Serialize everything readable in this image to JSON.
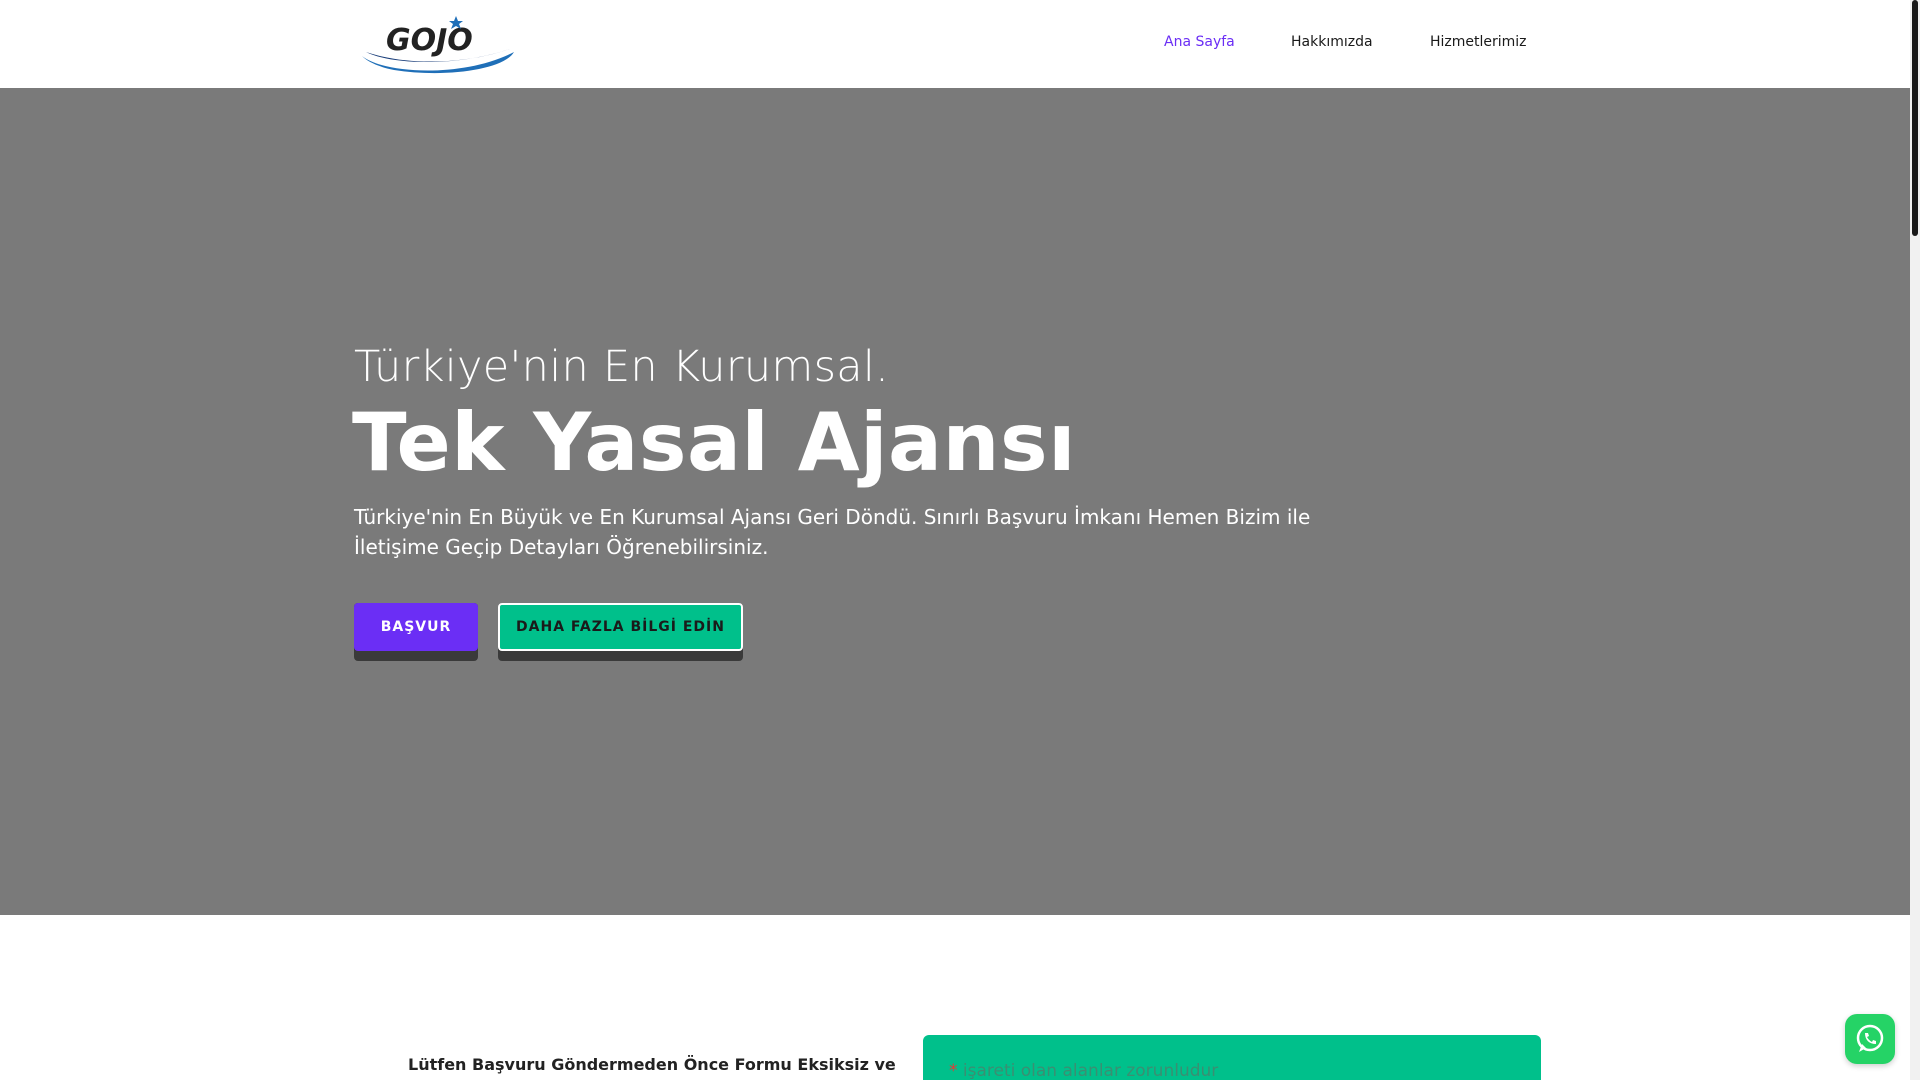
{
  "header": {
    "logo_text": "GOJO",
    "nav": [
      {
        "label": "Ana Sayfa",
        "active": true
      },
      {
        "label": "Hakkımızda",
        "active": false
      },
      {
        "label": "Hizmetlerimiz",
        "active": false
      }
    ]
  },
  "hero": {
    "subtitle": "Türkiye'nin En Kurumsal.",
    "title": "Tek Yasal Ajansı",
    "description": "Türkiye'nin En Büyük ve En Kurumsal Ajansı Geri Döndü. Sınırlı Başvuru İmkanı Hemen Bizim ile İletişime Geçip Detayları Öğrenebilirsiniz.",
    "apply_button": "BAŞVUR",
    "more_button": "DAHA FAZLA BİLGİ EDİN"
  },
  "form_section": {
    "intro": "Lütfen Başvuru Göndermeden Önce Formu Eksiksiz ve",
    "required_star": "*",
    "required_note": " işareti olan alanlar zorunludur"
  },
  "floating": {
    "whatsapp_icon": "whatsapp-icon"
  },
  "colors": {
    "accent": "#6b2ef5",
    "green": "#00c08b",
    "hero_bg": "#7a7a7a"
  }
}
